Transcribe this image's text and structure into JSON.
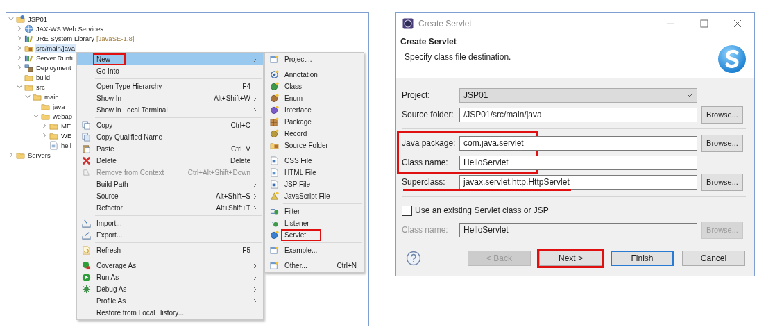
{
  "explorer": {
    "tree": [
      {
        "label": "JSP01",
        "kind": "project",
        "expanded": true,
        "selected": false,
        "children": [
          {
            "label": "JAX-WS Web Services",
            "kind": "web-services",
            "expanded": false,
            "selected": false
          },
          {
            "label": "JRE System Library",
            "suffix": "[JavaSE-1.8]",
            "kind": "library",
            "expanded": false,
            "selected": false
          },
          {
            "label": "src/main/java",
            "kind": "source-folder",
            "expanded": false,
            "selected": true
          },
          {
            "label": "Server Runti",
            "kind": "library",
            "expanded": false,
            "selected": false
          },
          {
            "label": "Deployment",
            "kind": "deployment",
            "expanded": false,
            "selected": false
          },
          {
            "label": "build",
            "kind": "folder",
            "selected": false
          },
          {
            "label": "src",
            "kind": "folder",
            "expanded": true,
            "selected": false,
            "children": [
              {
                "label": "main",
                "kind": "folder",
                "expanded": true,
                "selected": false,
                "children": [
                  {
                    "label": "java",
                    "kind": "folder",
                    "selected": false
                  },
                  {
                    "label": "webap",
                    "kind": "folder",
                    "expanded": true,
                    "selected": false,
                    "children": [
                      {
                        "label": "ME",
                        "kind": "folder",
                        "expanded": false,
                        "selected": false
                      },
                      {
                        "label": "WE",
                        "kind": "folder",
                        "expanded": false,
                        "selected": false
                      },
                      {
                        "label": "hell",
                        "kind": "file",
                        "selected": false
                      }
                    ]
                  }
                ]
              }
            ]
          }
        ]
      },
      {
        "label": "Servers",
        "kind": "folder",
        "expanded": false,
        "selected": false
      }
    ]
  },
  "context_menu": {
    "sections": [
      [
        {
          "label": "New",
          "kind": "none",
          "has_submenu": true,
          "selected": true,
          "highlighted": true,
          "disabled": false
        },
        {
          "label": "Go Into",
          "kind": "none",
          "has_submenu": false,
          "selected": false,
          "highlighted": false,
          "disabled": false
        }
      ],
      [
        {
          "label": "Open Type Hierarchy",
          "shortcut": "F4",
          "kind": "none",
          "has_submenu": false,
          "selected": false,
          "highlighted": false,
          "disabled": false
        },
        {
          "label": "Show In",
          "shortcut": "Alt+Shift+W",
          "kind": "none",
          "has_submenu": true,
          "selected": false,
          "highlighted": false,
          "disabled": false
        },
        {
          "label": "Show in Local Terminal",
          "kind": "none",
          "has_submenu": true,
          "selected": false,
          "highlighted": false,
          "disabled": false
        }
      ],
      [
        {
          "label": "Copy",
          "shortcut": "Ctrl+C",
          "kind": "copy",
          "has_submenu": false,
          "selected": false,
          "highlighted": false,
          "disabled": false
        },
        {
          "label": "Copy Qualified Name",
          "kind": "copy-name",
          "has_submenu": false,
          "selected": false,
          "highlighted": false,
          "disabled": false
        },
        {
          "label": "Paste",
          "shortcut": "Ctrl+V",
          "kind": "paste",
          "has_submenu": false,
          "selected": false,
          "highlighted": false,
          "disabled": false
        },
        {
          "label": "Delete",
          "shortcut": "Delete",
          "kind": "delete",
          "has_submenu": false,
          "selected": false,
          "highlighted": false,
          "disabled": false
        },
        {
          "label": "Remove from Context",
          "shortcut": "Ctrl+Alt+Shift+Down",
          "kind": "remove",
          "has_submenu": false,
          "selected": false,
          "highlighted": false,
          "disabled": true
        },
        {
          "label": "Build Path",
          "kind": "none",
          "has_submenu": true,
          "selected": false,
          "highlighted": false,
          "disabled": false
        },
        {
          "label": "Source",
          "shortcut": "Alt+Shift+S",
          "kind": "none",
          "has_submenu": true,
          "selected": false,
          "highlighted": false,
          "disabled": false
        },
        {
          "label": "Refactor",
          "shortcut": "Alt+Shift+T",
          "kind": "none",
          "has_submenu": true,
          "selected": false,
          "highlighted": false,
          "disabled": false
        }
      ],
      [
        {
          "label": "Import...",
          "kind": "import",
          "has_submenu": false,
          "selected": false,
          "highlighted": false,
          "disabled": false
        },
        {
          "label": "Export...",
          "kind": "export",
          "has_submenu": false,
          "selected": false,
          "highlighted": false,
          "disabled": false
        }
      ],
      [
        {
          "label": "Refresh",
          "shortcut": "F5",
          "kind": "refresh",
          "has_submenu": false,
          "selected": false,
          "highlighted": false,
          "disabled": false
        }
      ],
      [
        {
          "label": "Coverage As",
          "kind": "coverage",
          "has_submenu": true,
          "selected": false,
          "highlighted": false,
          "disabled": false
        },
        {
          "label": "Run As",
          "kind": "run",
          "has_submenu": true,
          "selected": false,
          "highlighted": false,
          "disabled": false
        },
        {
          "label": "Debug As",
          "kind": "debug",
          "has_submenu": true,
          "selected": false,
          "highlighted": false,
          "disabled": false
        },
        {
          "label": "Profile As",
          "kind": "none",
          "has_submenu": true,
          "selected": false,
          "highlighted": false,
          "disabled": false
        },
        {
          "label": "Restore from Local History...",
          "kind": "none",
          "has_submenu": false,
          "selected": false,
          "highlighted": false,
          "disabled": false
        }
      ]
    ]
  },
  "new_submenu": {
    "sections": [
      [
        {
          "label": "Project...",
          "kind": "wizard",
          "highlighted": false
        }
      ],
      [
        {
          "label": "Annotation",
          "kind": "annotation",
          "highlighted": false
        },
        {
          "label": "Class",
          "kind": "class",
          "highlighted": false
        },
        {
          "label": "Enum",
          "kind": "enum",
          "highlighted": false
        },
        {
          "label": "Interface",
          "kind": "interface",
          "highlighted": false
        },
        {
          "label": "Package",
          "kind": "package",
          "highlighted": false
        },
        {
          "label": "Record",
          "kind": "record",
          "highlighted": false
        },
        {
          "label": "Source Folder",
          "kind": "source-folder",
          "highlighted": false
        }
      ],
      [
        {
          "label": "CSS File",
          "kind": "css",
          "highlighted": false
        },
        {
          "label": "HTML File",
          "kind": "html",
          "highlighted": false
        },
        {
          "label": "JSP File",
          "kind": "jsp",
          "highlighted": false
        },
        {
          "label": "JavaScript File",
          "kind": "javascript",
          "highlighted": false
        }
      ],
      [
        {
          "label": "Filter",
          "kind": "filter",
          "highlighted": false
        },
        {
          "label": "Listener",
          "kind": "listener",
          "highlighted": false
        },
        {
          "label": "Servlet",
          "kind": "servlet",
          "highlighted": true
        }
      ],
      [
        {
          "label": "Example...",
          "kind": "wizard",
          "highlighted": false
        }
      ],
      [
        {
          "label": "Other...",
          "shortcut": "Ctrl+N",
          "kind": "wizard",
          "highlighted": false
        }
      ]
    ]
  },
  "dialog": {
    "window_title": "Create Servlet",
    "title": "Create Servlet",
    "subtitle": "Specify class file destination.",
    "groups": [
      {
        "separator_before": false,
        "highlighted": false,
        "rows": [
          {
            "kind": "combo",
            "label": "Project:",
            "value": "JSP01",
            "disabled": false,
            "underlined": false
          },
          {
            "kind": "text",
            "label": "Source folder:",
            "value": "/JSP01/src/main/java",
            "button": "Browse...",
            "disabled": false,
            "underlined": false
          }
        ]
      },
      {
        "separator_before": true,
        "highlighted": true,
        "rows": [
          {
            "kind": "text",
            "label": "Java package:",
            "value": "com.java.servlet",
            "button": "Browse...",
            "disabled": false,
            "underlined": false
          },
          {
            "kind": "text",
            "label": "Class name:",
            "value": "HelloServlet",
            "disabled": false,
            "underlined": false
          }
        ]
      },
      {
        "separator_before": false,
        "highlighted": false,
        "rows": [
          {
            "kind": "text",
            "label": "Superclass:",
            "value": "javax.servlet.http.HttpServlet",
            "button": "Browse...",
            "disabled": false,
            "underlined": true
          }
        ]
      },
      {
        "separator_before": true,
        "highlighted": false,
        "rows": [
          {
            "kind": "checkbox",
            "label": "Use an existing Servlet class or JSP",
            "checked": false,
            "disabled": false,
            "underlined": false
          },
          {
            "kind": "text",
            "label": "Class name:",
            "value": "HelloServlet",
            "button": "Browse...",
            "disabled": true,
            "underlined": false
          }
        ]
      }
    ],
    "buttons": [
      {
        "label": "< Back",
        "disabled": true,
        "default": false,
        "highlighted": false
      },
      {
        "label": "Next >",
        "disabled": false,
        "default": false,
        "highlighted": true
      },
      {
        "label": "Finish",
        "disabled": false,
        "default": true,
        "highlighted": false
      },
      {
        "label": "Cancel",
        "disabled": false,
        "default": false,
        "highlighted": false
      }
    ]
  }
}
